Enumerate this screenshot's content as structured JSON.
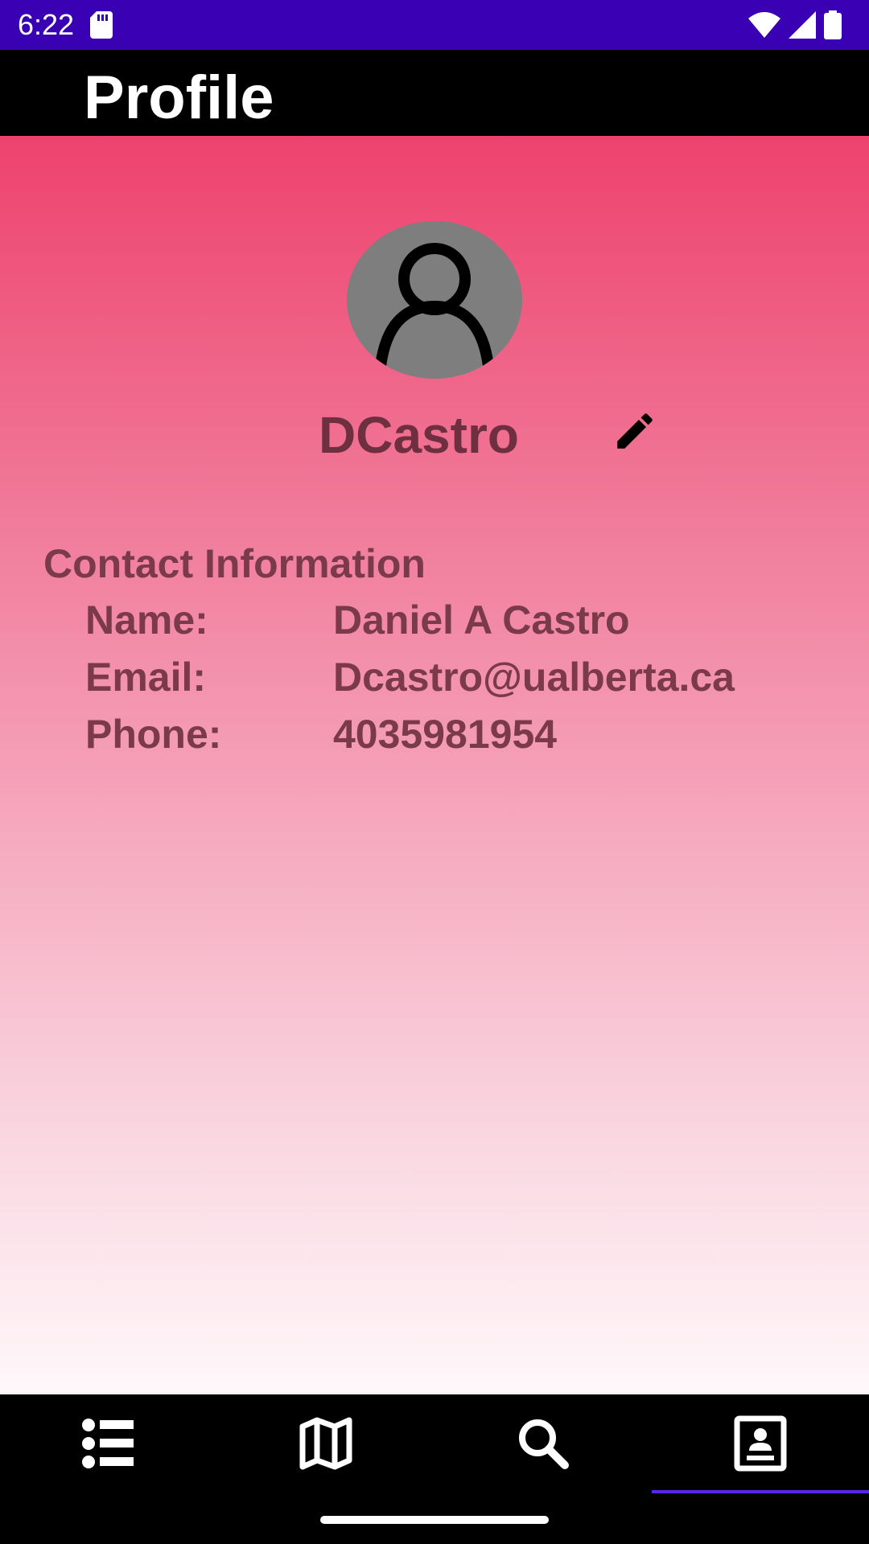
{
  "status_bar": {
    "time": "6:22",
    "icons": [
      "sd-card-icon",
      "wifi-icon",
      "signal-icon",
      "battery-icon"
    ],
    "background": "#3a00b4"
  },
  "app_bar": {
    "title": "Profile"
  },
  "profile": {
    "avatar_icon": "person-icon",
    "username": "DCastro",
    "edit_icon": "pencil-icon"
  },
  "contact": {
    "heading": "Contact Information",
    "rows": [
      {
        "label": "Name:",
        "value": "Daniel A Castro"
      },
      {
        "label": "Email:",
        "value": "Dcastro@ualberta.ca"
      },
      {
        "label": "Phone:",
        "value": "4035981954"
      }
    ]
  },
  "bottom_nav": {
    "items": [
      {
        "icon": "list-icon",
        "selected": false
      },
      {
        "icon": "map-icon",
        "selected": false
      },
      {
        "icon": "search-icon",
        "selected": false
      },
      {
        "icon": "contact-card-icon",
        "selected": true
      }
    ],
    "indicator_color": "#5b24e8"
  },
  "colors": {
    "gradient_top": "#ee426e",
    "gradient_bottom": "#fff8fa",
    "text": "#7a3a4a"
  }
}
